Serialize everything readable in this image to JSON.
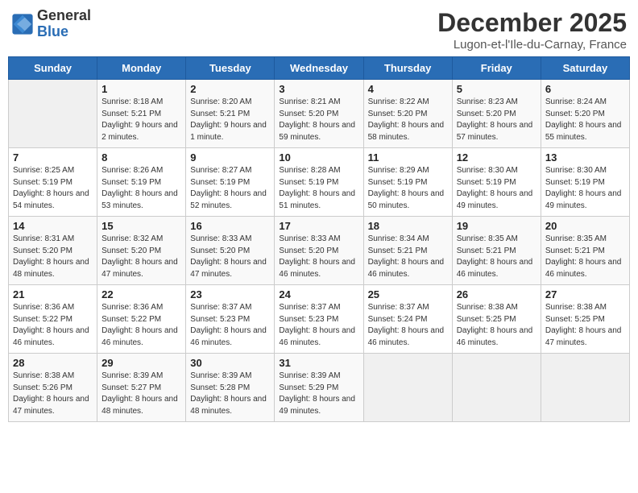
{
  "header": {
    "logo_line1": "General",
    "logo_line2": "Blue",
    "month": "December 2025",
    "location": "Lugon-et-l'Ile-du-Carnay, France"
  },
  "weekdays": [
    "Sunday",
    "Monday",
    "Tuesday",
    "Wednesday",
    "Thursday",
    "Friday",
    "Saturday"
  ],
  "weeks": [
    [
      {
        "day": "",
        "sunrise": "",
        "sunset": "",
        "daylight": "",
        "empty": true
      },
      {
        "day": "1",
        "sunrise": "Sunrise: 8:18 AM",
        "sunset": "Sunset: 5:21 PM",
        "daylight": "Daylight: 9 hours and 2 minutes."
      },
      {
        "day": "2",
        "sunrise": "Sunrise: 8:20 AM",
        "sunset": "Sunset: 5:21 PM",
        "daylight": "Daylight: 9 hours and 1 minute."
      },
      {
        "day": "3",
        "sunrise": "Sunrise: 8:21 AM",
        "sunset": "Sunset: 5:20 PM",
        "daylight": "Daylight: 8 hours and 59 minutes."
      },
      {
        "day": "4",
        "sunrise": "Sunrise: 8:22 AM",
        "sunset": "Sunset: 5:20 PM",
        "daylight": "Daylight: 8 hours and 58 minutes."
      },
      {
        "day": "5",
        "sunrise": "Sunrise: 8:23 AM",
        "sunset": "Sunset: 5:20 PM",
        "daylight": "Daylight: 8 hours and 57 minutes."
      },
      {
        "day": "6",
        "sunrise": "Sunrise: 8:24 AM",
        "sunset": "Sunset: 5:20 PM",
        "daylight": "Daylight: 8 hours and 55 minutes."
      }
    ],
    [
      {
        "day": "7",
        "sunrise": "Sunrise: 8:25 AM",
        "sunset": "Sunset: 5:19 PM",
        "daylight": "Daylight: 8 hours and 54 minutes."
      },
      {
        "day": "8",
        "sunrise": "Sunrise: 8:26 AM",
        "sunset": "Sunset: 5:19 PM",
        "daylight": "Daylight: 8 hours and 53 minutes."
      },
      {
        "day": "9",
        "sunrise": "Sunrise: 8:27 AM",
        "sunset": "Sunset: 5:19 PM",
        "daylight": "Daylight: 8 hours and 52 minutes."
      },
      {
        "day": "10",
        "sunrise": "Sunrise: 8:28 AM",
        "sunset": "Sunset: 5:19 PM",
        "daylight": "Daylight: 8 hours and 51 minutes."
      },
      {
        "day": "11",
        "sunrise": "Sunrise: 8:29 AM",
        "sunset": "Sunset: 5:19 PM",
        "daylight": "Daylight: 8 hours and 50 minutes."
      },
      {
        "day": "12",
        "sunrise": "Sunrise: 8:30 AM",
        "sunset": "Sunset: 5:19 PM",
        "daylight": "Daylight: 8 hours and 49 minutes."
      },
      {
        "day": "13",
        "sunrise": "Sunrise: 8:30 AM",
        "sunset": "Sunset: 5:19 PM",
        "daylight": "Daylight: 8 hours and 49 minutes."
      }
    ],
    [
      {
        "day": "14",
        "sunrise": "Sunrise: 8:31 AM",
        "sunset": "Sunset: 5:20 PM",
        "daylight": "Daylight: 8 hours and 48 minutes."
      },
      {
        "day": "15",
        "sunrise": "Sunrise: 8:32 AM",
        "sunset": "Sunset: 5:20 PM",
        "daylight": "Daylight: 8 hours and 47 minutes."
      },
      {
        "day": "16",
        "sunrise": "Sunrise: 8:33 AM",
        "sunset": "Sunset: 5:20 PM",
        "daylight": "Daylight: 8 hours and 47 minutes."
      },
      {
        "day": "17",
        "sunrise": "Sunrise: 8:33 AM",
        "sunset": "Sunset: 5:20 PM",
        "daylight": "Daylight: 8 hours and 46 minutes."
      },
      {
        "day": "18",
        "sunrise": "Sunrise: 8:34 AM",
        "sunset": "Sunset: 5:21 PM",
        "daylight": "Daylight: 8 hours and 46 minutes."
      },
      {
        "day": "19",
        "sunrise": "Sunrise: 8:35 AM",
        "sunset": "Sunset: 5:21 PM",
        "daylight": "Daylight: 8 hours and 46 minutes."
      },
      {
        "day": "20",
        "sunrise": "Sunrise: 8:35 AM",
        "sunset": "Sunset: 5:21 PM",
        "daylight": "Daylight: 8 hours and 46 minutes."
      }
    ],
    [
      {
        "day": "21",
        "sunrise": "Sunrise: 8:36 AM",
        "sunset": "Sunset: 5:22 PM",
        "daylight": "Daylight: 8 hours and 46 minutes."
      },
      {
        "day": "22",
        "sunrise": "Sunrise: 8:36 AM",
        "sunset": "Sunset: 5:22 PM",
        "daylight": "Daylight: 8 hours and 46 minutes."
      },
      {
        "day": "23",
        "sunrise": "Sunrise: 8:37 AM",
        "sunset": "Sunset: 5:23 PM",
        "daylight": "Daylight: 8 hours and 46 minutes."
      },
      {
        "day": "24",
        "sunrise": "Sunrise: 8:37 AM",
        "sunset": "Sunset: 5:23 PM",
        "daylight": "Daylight: 8 hours and 46 minutes."
      },
      {
        "day": "25",
        "sunrise": "Sunrise: 8:37 AM",
        "sunset": "Sunset: 5:24 PM",
        "daylight": "Daylight: 8 hours and 46 minutes."
      },
      {
        "day": "26",
        "sunrise": "Sunrise: 8:38 AM",
        "sunset": "Sunset: 5:25 PM",
        "daylight": "Daylight: 8 hours and 46 minutes."
      },
      {
        "day": "27",
        "sunrise": "Sunrise: 8:38 AM",
        "sunset": "Sunset: 5:25 PM",
        "daylight": "Daylight: 8 hours and 47 minutes."
      }
    ],
    [
      {
        "day": "28",
        "sunrise": "Sunrise: 8:38 AM",
        "sunset": "Sunset: 5:26 PM",
        "daylight": "Daylight: 8 hours and 47 minutes."
      },
      {
        "day": "29",
        "sunrise": "Sunrise: 8:39 AM",
        "sunset": "Sunset: 5:27 PM",
        "daylight": "Daylight: 8 hours and 48 minutes."
      },
      {
        "day": "30",
        "sunrise": "Sunrise: 8:39 AM",
        "sunset": "Sunset: 5:28 PM",
        "daylight": "Daylight: 8 hours and 48 minutes."
      },
      {
        "day": "31",
        "sunrise": "Sunrise: 8:39 AM",
        "sunset": "Sunset: 5:29 PM",
        "daylight": "Daylight: 8 hours and 49 minutes."
      },
      {
        "day": "",
        "sunrise": "",
        "sunset": "",
        "daylight": "",
        "empty": true
      },
      {
        "day": "",
        "sunrise": "",
        "sunset": "",
        "daylight": "",
        "empty": true
      },
      {
        "day": "",
        "sunrise": "",
        "sunset": "",
        "daylight": "",
        "empty": true
      }
    ]
  ]
}
